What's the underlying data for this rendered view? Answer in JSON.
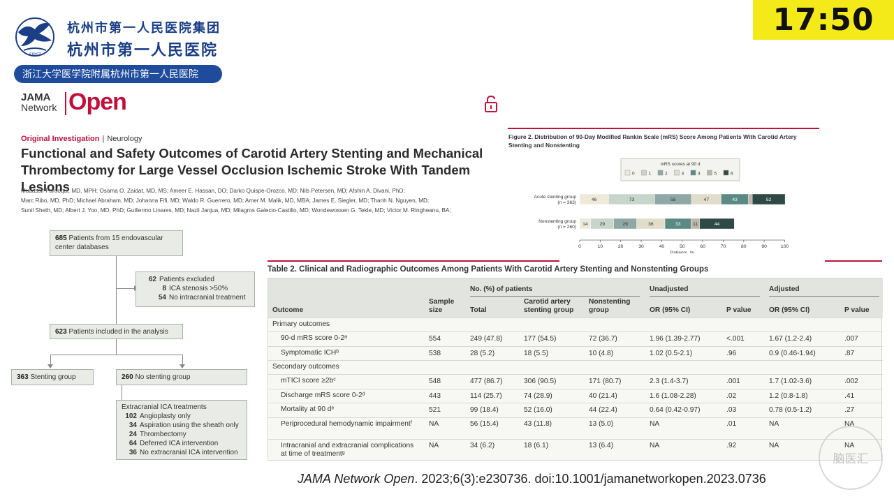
{
  "clock": "17:50",
  "hospital": {
    "name_line1": "杭州市第一人民医院集团",
    "name_line2": "杭州市第一人民医院",
    "affiliation": "浙江大学医学院附属杭州市第一人民医院",
    "seal_text": "FIRST"
  },
  "journal": {
    "brand_line1": "JAMA",
    "brand_line2": "Network",
    "brand_open": "Open",
    "category_primary": "Original Investigation",
    "category_secondary": "Neurology",
    "title": "Functional and Safety Outcomes of Carotid Artery Stenting and Mechanical Thrombectomy for Large Vessel Occlusion Ischemic Stroke With Tandem Lesions",
    "authors": [
      "Mudassir Farooqui, MD, MPH; Osama O. Zaidat, MD, MS; Ameer E. Hassan, DO; Darko Quispe-Orozco, MD; Nils Petersen, MD; Afshin A. Divani, PhD;",
      "Marc Ribo, MD, PhD; Michael Abraham, MD; Johanna Fifi, MD; Waldo R. Guerrero, MD; Amer M. Malik, MD, MBA; James E. Siegler, MD; Thanh N. Nguyen, MD;",
      "Sunil Sheth, MD; Albert J. Yoo, MD, PhD; Guillermo Linares, MD; Nazli Janjua, MD; Milagros Galecio-Castillo, MD; Wondewossen G. Tekle, MD; Victor M. Ringheanu, BA;"
    ]
  },
  "flowchart": {
    "top": {
      "n": "685",
      "text": "Patients from 15 endovascular center databases"
    },
    "excluded": {
      "n": "62",
      "text": "Patients excluded",
      "items": [
        {
          "n": "8",
          "text": "ICA stenosis >50%"
        },
        {
          "n": "54",
          "text": "No intracranial treatment"
        }
      ]
    },
    "included": {
      "n": "623",
      "text": "Patients included in the analysis"
    },
    "stenting": {
      "n": "363",
      "text": "Stenting group"
    },
    "nostenting": {
      "n": "260",
      "text": "No stenting group"
    },
    "treatments": {
      "title": "Extracranial ICA treatments",
      "items": [
        {
          "n": "102",
          "text": "Angioplasty only"
        },
        {
          "n": "34",
          "text": "Aspiration using the sheath only"
        },
        {
          "n": "24",
          "text": "Thrombectomy"
        },
        {
          "n": "64",
          "text": "Deferred ICA intervention"
        },
        {
          "n": "36",
          "text": "No extracranial ICA intervention"
        }
      ]
    }
  },
  "chart_data": {
    "type": "bar",
    "orientation": "horizontal",
    "stacked": true,
    "title": "Figure 2. Distribution of 90-Day Modified Rankin Scale (mRS) Score Among Patients With Carotid Artery Stenting and Nonstenting",
    "legend_title": "mRS scores at 90 d",
    "legend_position": "top",
    "xlabel": "Patients, %",
    "xlim": [
      0,
      100
    ],
    "xticks": [
      0,
      10,
      20,
      30,
      40,
      50,
      60,
      70,
      80,
      90,
      100
    ],
    "categories": [
      {
        "label": "Acute stenting group",
        "sublabel": "(n = 363)"
      },
      {
        "label": "Nonstenting group",
        "sublabel": "(n = 260)"
      }
    ],
    "series": [
      {
        "name": "0",
        "color": "#eeeadb",
        "values": [
          14.1,
          5.4
        ],
        "labels": [
          "46",
          "14"
        ]
      },
      {
        "name": "1",
        "color": "#c8d5cb",
        "values": [
          22.5,
          11.2
        ],
        "labels": [
          "73",
          "29"
        ]
      },
      {
        "name": "2",
        "color": "#8fa8a6",
        "values": [
          17.9,
          11.2
        ],
        "labels": [
          "58",
          "29"
        ]
      },
      {
        "name": "3",
        "color": "#e2ddcb",
        "values": [
          14.5,
          13.8
        ],
        "labels": [
          "47",
          "36"
        ]
      },
      {
        "name": "4",
        "color": "#5a8a83",
        "values": [
          13.3,
          12.7
        ],
        "labels": [
          "43",
          "33"
        ]
      },
      {
        "name": "5",
        "color": "#bdb6a8",
        "values": [
          1.9,
          4.2
        ],
        "labels": [
          "",
          "11"
        ]
      },
      {
        "name": "6",
        "color": "#2f4a45",
        "values": [
          16.0,
          16.9
        ],
        "labels": [
          "52",
          "44"
        ]
      }
    ]
  },
  "table2": {
    "title": "Table 2. Clinical and Radiographic Outcomes Among Patients With Carotid Artery Stenting and Nonstenting Groups",
    "group_headers": [
      "No. (%) of patients",
      "Unadjusted",
      "Adjusted"
    ],
    "columns": [
      "Outcome",
      "Sample size",
      "Total",
      "Carotid artery stenting group",
      "Nonstenting group",
      "OR (95% CI)",
      "P value",
      "OR (95% CI)",
      "P value"
    ],
    "sections": [
      {
        "label": "Primary outcomes",
        "rows": [
          {
            "cells": [
              "90-d mRS score 0-2ᵃ",
              "554",
              "249 (47.8)",
              "177 (54.5)",
              "72 (36.7)",
              "1.96 (1.39-2.77)",
              "<.001",
              "1.67 (1.2-2.4)",
              ".007"
            ]
          },
          {
            "cells": [
              "Symptomatic ICHᵇ",
              "538",
              "28 (5.2)",
              "18 (5.5)",
              "10 (4.8)",
              "1.02 (0.5-2.1)",
              ".96",
              "0.9 (0.46-1.94)",
              ".87"
            ]
          }
        ]
      },
      {
        "label": "Secondary outcomes",
        "rows": [
          {
            "cells": [
              "mTICI score ≥2bᶜ",
              "548",
              "477 (86.7)",
              "306 (90.5)",
              "171 (80.7)",
              "2.3 (1.4-3.7)",
              ".001",
              "1.7 (1.02-3.6)",
              ".002"
            ]
          },
          {
            "cells": [
              "Discharge mRS score 0-2ᵈ",
              "443",
              "114 (25.7)",
              "74 (28.9)",
              "40 (21.4)",
              "1.6 (1.08-2.28)",
              ".02",
              "1.2 (0.8-1.8)",
              ".41"
            ]
          },
          {
            "cells": [
              "Mortality at 90 dᵉ",
              "521",
              "99 (18.4)",
              "52 (16.0)",
              "44 (22.4)",
              "0.64 (0.42-0.97)",
              ".03",
              "0.78 (0.5-1.2)",
              ".27"
            ]
          },
          {
            "cells": [
              "Periprocedural hemodynamic impairmentᶠ",
              "NA",
              "56 (15.4)",
              "43 (11.8)",
              "13 (5.0)",
              "NA",
              ".01",
              "NA",
              "NA"
            ]
          },
          {
            "cells": [
              "Intracranial and extracranial complications at time of treatmentᵍ",
              "NA",
              "34 (6.2)",
              "18 (6.1)",
              "13 (6.4)",
              "NA",
              ".92",
              "NA",
              "NA"
            ]
          }
        ]
      }
    ]
  },
  "citation": {
    "journal": "JAMA Network Open",
    "details": ". 2023;6(3):e230736. doi:10.1001/jamanetworkopen.2023.0736"
  },
  "watermark": "脑医汇"
}
